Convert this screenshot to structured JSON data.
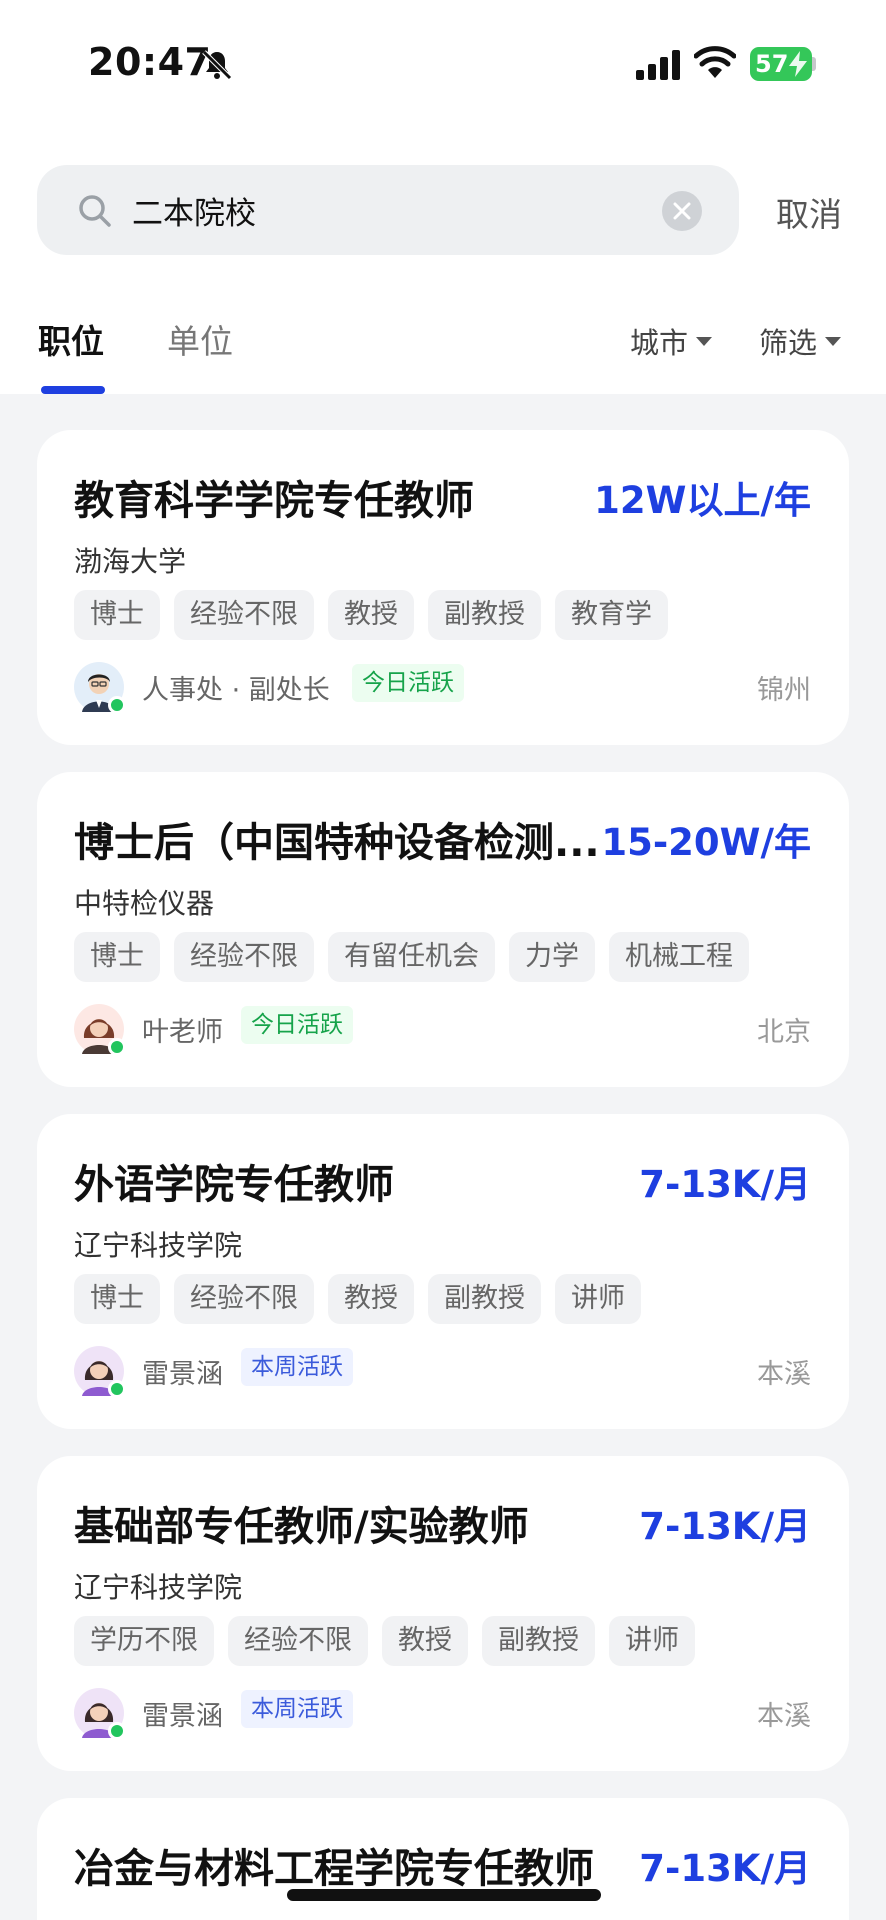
{
  "status_bar": {
    "time": "20:47",
    "battery": "57"
  },
  "search": {
    "value": "二本院校",
    "cancel_label": "取消"
  },
  "tabs": [
    {
      "label": "职位",
      "active": true
    },
    {
      "label": "单位",
      "active": false
    }
  ],
  "filters": {
    "city_label": "城市",
    "screen_label": "筛选"
  },
  "colors": {
    "accent": "#1e3fe0",
    "active_green": "#16a34a",
    "weekly_blue": "#3b5bdb"
  },
  "jobs": [
    {
      "title": "教育科学学院专任教师",
      "salary": "12W以上/年",
      "org": "渤海大学",
      "tags": [
        "博士",
        "经验不限",
        "教授",
        "副教授",
        "教育学"
      ],
      "contact": "人事处 · 副处长",
      "badge": "今日活跃",
      "city": "锦州",
      "avatar_icon": "male-avatar-icon"
    },
    {
      "title": "博士后（中国特种设备检测...",
      "salary": "15-20W/年",
      "org": "中特检仪器",
      "tags": [
        "博士",
        "经验不限",
        "有留任机会",
        "力学",
        "机械工程"
      ],
      "contact": "叶老师",
      "badge": "今日活跃",
      "city": "北京",
      "avatar_icon": "female-avatar-icon"
    },
    {
      "title": "外语学院专任教师",
      "salary": "7-13K/月",
      "org": "辽宁科技学院",
      "tags": [
        "博士",
        "经验不限",
        "教授",
        "副教授",
        "讲师"
      ],
      "contact": "雷景涵",
      "badge": "本周活跃",
      "city": "本溪",
      "avatar_icon": "female-avatar-icon"
    },
    {
      "title": "基础部专任教师/实验教师",
      "salary": "7-13K/月",
      "org": "辽宁科技学院",
      "tags": [
        "学历不限",
        "经验不限",
        "教授",
        "副教授",
        "讲师"
      ],
      "contact": "雷景涵",
      "badge": "本周活跃",
      "city": "本溪",
      "avatar_icon": "female-avatar-icon"
    },
    {
      "title": "冶金与材料工程学院专任教师",
      "salary": "7-13K/月"
    }
  ]
}
